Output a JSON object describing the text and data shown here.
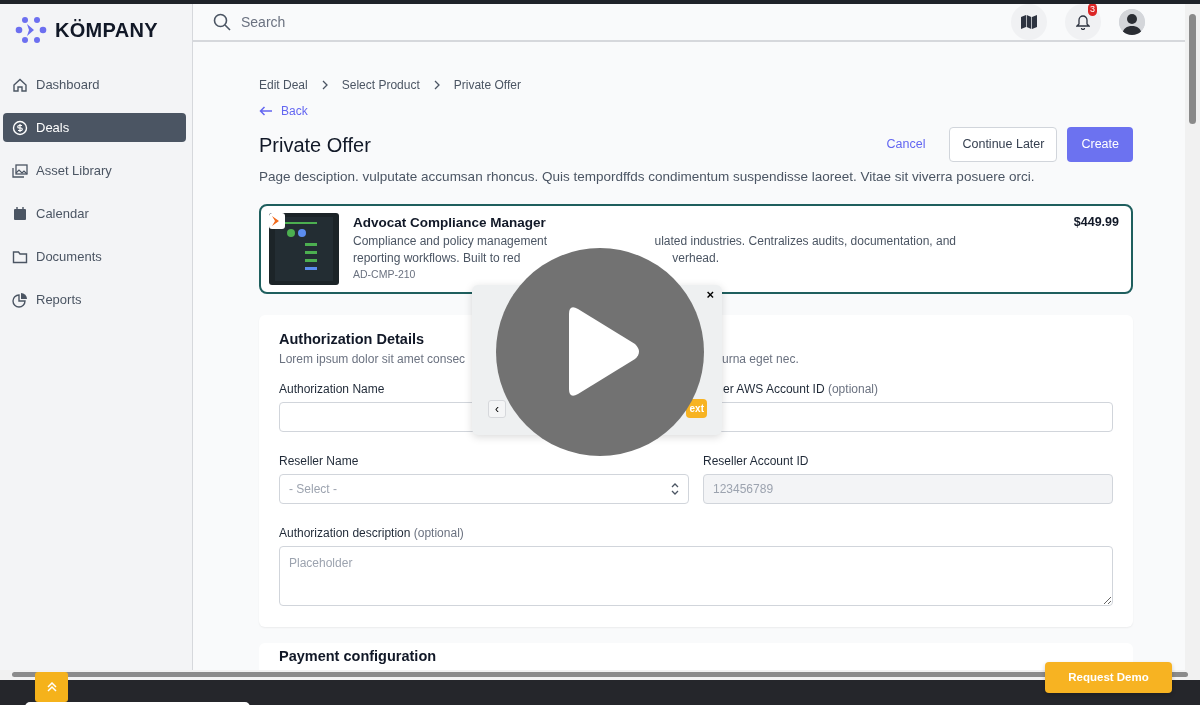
{
  "brand": {
    "name": "KÖMPANY"
  },
  "search": {
    "placeholder": "Search"
  },
  "header": {
    "notification_count": "3"
  },
  "sidebar": {
    "items": [
      {
        "label": "Dashboard",
        "selected": false
      },
      {
        "label": "Deals",
        "selected": true
      },
      {
        "label": "Asset Library",
        "selected": false
      },
      {
        "label": "Calendar",
        "selected": false
      },
      {
        "label": "Documents",
        "selected": false
      },
      {
        "label": "Reports",
        "selected": false
      }
    ]
  },
  "breadcrumb": [
    "Edit Deal",
    "Select Product",
    "Private Offer"
  ],
  "back_link": "Back",
  "page": {
    "title": "Private Offer",
    "description": "Page desciption. vulputate accumsan rhoncus. Quis tempordffds condimentum suspendisse laoreet. Vitae sit viverra posuere orci."
  },
  "actions": [
    {
      "label": "Cancel",
      "kind": "link"
    },
    {
      "label": "Continue Later",
      "kind": "secondary"
    },
    {
      "label": "Create",
      "kind": "primary"
    }
  ],
  "product": {
    "name": "Advocat Compliance Manager",
    "selected": true,
    "description_lines": [
      [
        "Compliance and policy management",
        "ulated industries. Centralizes audits, documentation, and"
      ],
      [
        "reporting workflows. Built to red",
        "verhead."
      ]
    ],
    "sku": "AD-CMP-210",
    "price": "$449.99"
  },
  "form": {
    "title": "Authorization Details",
    "subtitle_parts": [
      "Lorem ipsum dolor sit amet consec",
      "urna eget nec."
    ],
    "fields": [
      {
        "kind": "text",
        "label": "Authorization Name"
      },
      {
        "kind": "text",
        "label": "er AWS Account ID",
        "optional": "(optional)"
      },
      {
        "kind": "select",
        "label": "Reseller Name",
        "placeholder": "- Select -"
      },
      {
        "kind": "text",
        "label": "Reseller Account ID",
        "placeholder": "123456789",
        "disabled": true
      },
      {
        "kind": "textarea",
        "label": "Authorization description",
        "optional": "(optional)",
        "placeholder": "Placeholder"
      }
    ]
  },
  "next_section": {
    "title": "Payment configuration"
  },
  "tour_popup": {
    "close": "×",
    "prev": "‹",
    "next": "ext"
  },
  "request_demo": "Request Demo"
}
